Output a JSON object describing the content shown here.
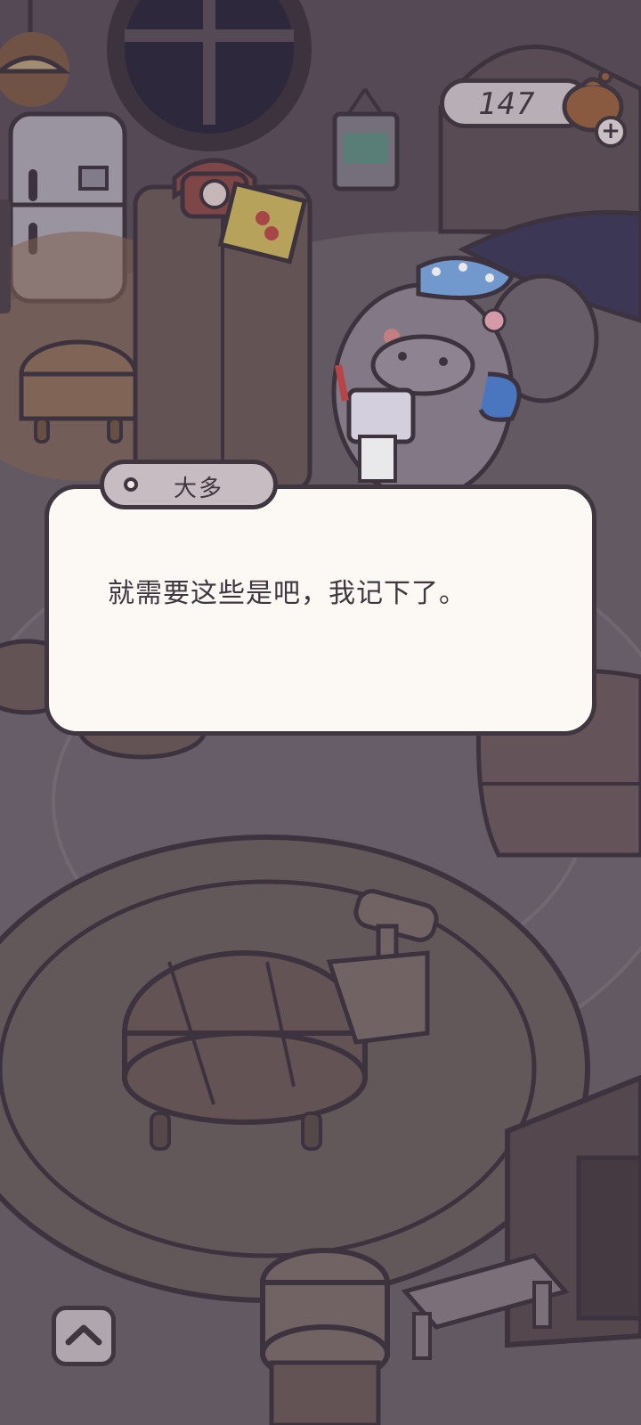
{
  "hud": {
    "currency_value": "147",
    "currency_icon": "coin-bag-icon",
    "add_icon": "plus-icon"
  },
  "dialog": {
    "speaker": "大多",
    "text": "就需要这些是吧，我记下了。"
  },
  "controls": {
    "expand_icon": "chevron-up-icon"
  },
  "colors": {
    "outline": "#3f3640",
    "dialog_bg": "#fcf9f4",
    "name_tab": "#c7bcc2",
    "scene_bg": "#5e5560"
  }
}
